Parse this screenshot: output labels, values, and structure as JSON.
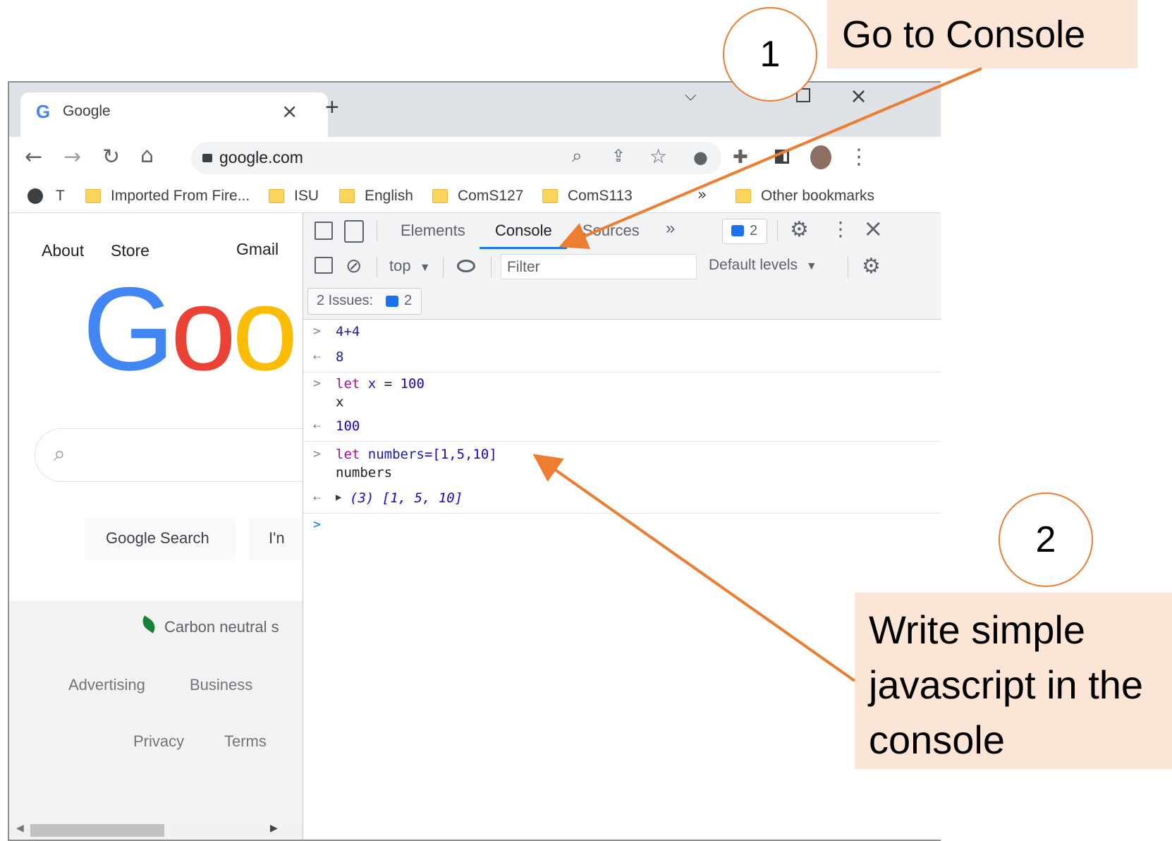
{
  "browser": {
    "tab_title": "Google",
    "new_tab_symbol": "+",
    "url": "google.com",
    "bookmarks": {
      "first": "T",
      "items": [
        "Imported From Fire...",
        "ISU",
        "English",
        "ComS127",
        "ComS113"
      ],
      "overflow": "»",
      "other": "Other bookmarks"
    }
  },
  "google": {
    "links": {
      "about": "About",
      "store": "Store",
      "gmail": "Gmail"
    },
    "logo_text": "Goo",
    "search_button": "Google Search",
    "lucky_button": "I'n",
    "carbon": "Carbon neutral s",
    "footer": {
      "advertising": "Advertising",
      "business": "Business",
      "privacy": "Privacy",
      "terms": "Terms"
    }
  },
  "devtools": {
    "tabs": [
      "Elements",
      "Console",
      "Sources"
    ],
    "active_tab": "Console",
    "more_tabs": "»",
    "issues_badge_count": "2",
    "context": "top",
    "filter_placeholder": "Filter",
    "levels": "Default levels",
    "issues_label": "2 Issues:",
    "issues_count": "2",
    "console": {
      "entries": [
        {
          "input": "4+4",
          "output": "8"
        },
        {
          "input_kw": "let",
          "input_var": "x",
          "input_op": "=",
          "input_num": "100",
          "input2": "x",
          "output": "100"
        },
        {
          "input_kw": "let",
          "input_var": "numbers",
          "input_rest": "=[1,5,10]",
          "input2": "numbers",
          "output": "(3) [1, 5, 10]"
        }
      ]
    }
  },
  "annotations": {
    "step1_number": "1",
    "step1_text": "Go to Console",
    "step2_number": "2",
    "step2_line1": "Write simple",
    "step2_line2": "javascript in the",
    "step2_line3": "console"
  },
  "colors": {
    "accent": "#ed7d31",
    "callout_bg": "#fbe5d6",
    "devtools_active": "#1a73e8"
  }
}
